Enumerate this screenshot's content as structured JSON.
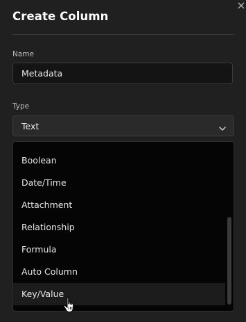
{
  "dialog": {
    "title": "Create Column"
  },
  "name_field": {
    "label": "Name",
    "value": "Metadata"
  },
  "type_field": {
    "label": "Type",
    "selected": "Text"
  },
  "dropdown": {
    "options": [
      {
        "label": "Boolean"
      },
      {
        "label": "Date/Time"
      },
      {
        "label": "Attachment"
      },
      {
        "label": "Relationship"
      },
      {
        "label": "Formula"
      },
      {
        "label": "Auto Column"
      },
      {
        "label": "Key/Value"
      }
    ],
    "hovered": "Key/Value"
  },
  "icons": {
    "close": "close-icon",
    "chevron": "chevron-down-icon",
    "cursor": "hand-pointer-icon"
  },
  "colors": {
    "background": "#202020",
    "dropdown_bg": "#050505",
    "hover_bg": "#1c1c1c",
    "text": "#e6e6e6"
  }
}
